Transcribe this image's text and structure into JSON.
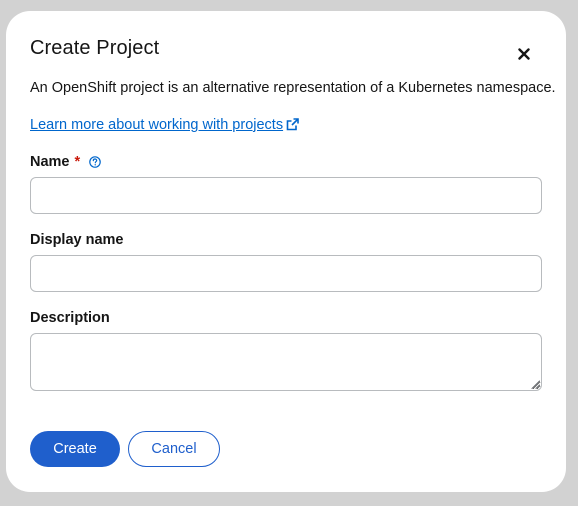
{
  "modal": {
    "title": "Create Project",
    "close_icon": "close-icon",
    "description": "An OpenShift project is an alternative representation of a Kubernetes namespace.",
    "learn_more_link": "Learn more about working with projects",
    "learn_more_icon": "external-link-icon"
  },
  "form": {
    "name": {
      "label": "Name",
      "required_marker": "*",
      "help_icon": "help-circle-icon",
      "value": ""
    },
    "display_name": {
      "label": "Display name",
      "value": ""
    },
    "description": {
      "label": "Description",
      "value": ""
    }
  },
  "actions": {
    "create_label": "Create",
    "cancel_label": "Cancel"
  },
  "colors": {
    "primary": "#1f5fcc",
    "link": "#0066cc",
    "required": "#c9190b",
    "backdrop": "#d2d2d2"
  }
}
